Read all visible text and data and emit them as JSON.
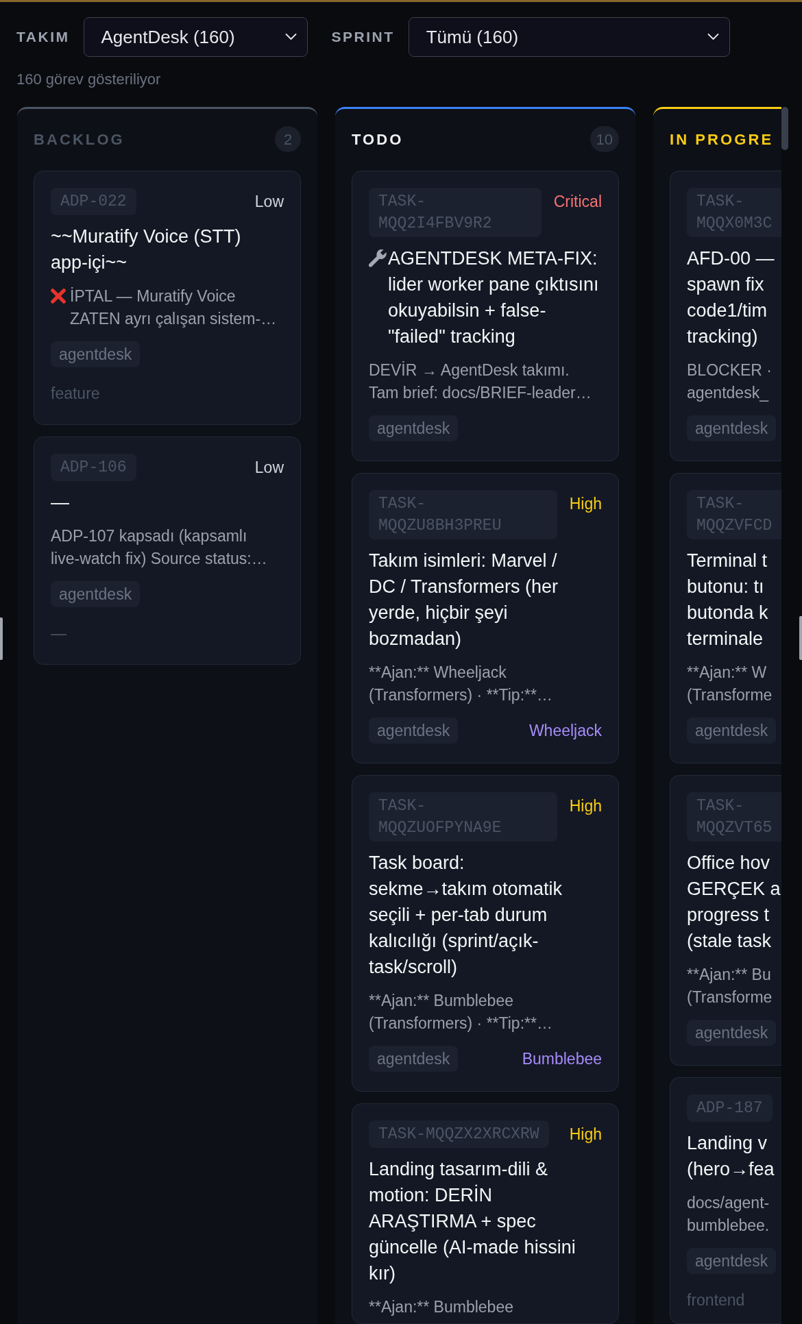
{
  "filters": [
    {
      "label": "TAKIM",
      "value": "AgentDesk (160)"
    },
    {
      "label": "SPRINT",
      "value": "Tümü (160)"
    }
  ],
  "summary": "160 görev gösteriliyor",
  "columns": [
    {
      "title": {
        "text": "BACKLOG",
        "color": "#4b5563"
      },
      "count": "2",
      "color": "#4b5563",
      "clipped": false,
      "cards": [
        {
          "kind": "cancelled",
          "id": "ADP-022",
          "priority": {
            "label": "Low",
            "color": "#d1d5db"
          },
          "title": "~~Muratify Voice (STT) app-içi~~",
          "description": "İPTAL — Muratify Voice ZATEN ayrı çalışan sistem-…",
          "tags": [
            "agentdesk"
          ],
          "type": "feature"
        },
        {
          "kind": "task",
          "id": "ADP-106",
          "priority": {
            "label": "Low",
            "color": "#d1d5db"
          },
          "title": "—",
          "description": "ADP-107 kapsadı (kapsamlı live-watch fix) Source status:…",
          "tags": [
            "agentdesk"
          ],
          "type": "—"
        }
      ]
    },
    {
      "title": {
        "text": "TODO",
        "color": "#f3f4f6"
      },
      "count": "10",
      "color": "#3b82f6",
      "clipped": false,
      "cards": [
        {
          "kind": "fix",
          "id": "TASK-MQQ2I4FBV9R2",
          "priority": {
            "label": "Critical",
            "color": "#f87171"
          },
          "title": "AGENTDESK META-FIX: lider worker pane çıktısını okuyabilsin + false-\"failed\" tracking",
          "description": "DEVİR → AgentDesk takımı. Tam brief: docs/BRIEF-leader…",
          "tags": [
            "agentdesk"
          ]
        },
        {
          "kind": "task",
          "id": "TASK-MQQZU8BH3PREU",
          "priority": {
            "label": "High",
            "color": "#facc15"
          },
          "title": "Takım isimleri: Marvel / DC / Transformers (her yerde, hiçbir şeyi bozmadan)",
          "description": "**Ajan:** Wheeljack (Transformers) · **Tip:**…",
          "tags": [
            "agentdesk"
          ],
          "agent": "Wheeljack"
        },
        {
          "kind": "task",
          "id": "TASK-MQQZUOFPYNA9E",
          "priority": {
            "label": "High",
            "color": "#facc15"
          },
          "title": "Task board: sekme→takım otomatik seçili + per-tab durum kalıcılığı (sprint/açık-task/scroll)",
          "description": "**Ajan:** Bumblebee (Transformers) · **Tip:**…",
          "tags": [
            "agentdesk"
          ],
          "agent": "Bumblebee"
        },
        {
          "kind": "task",
          "id": "TASK-MQQZX2XRCXRW",
          "priority": {
            "label": "High",
            "color": "#facc15"
          },
          "title": "Landing tasarım-dili & motion: DERİN ARAŞTIRMA + spec güncelle (AI-made hissini kır)",
          "description": "**Ajan:** Bumblebee"
        }
      ]
    },
    {
      "title": {
        "text": "IN PROGRE",
        "color": "#facc15"
      },
      "color": "#facc15",
      "clipped": true,
      "cards": [
        {
          "kind": "task",
          "id": [
            "TASK-",
            "MQQX0M3C"
          ],
          "title": [
            "AFD-00 —",
            "spawn fix",
            "code1/tim",
            "tracking)"
          ],
          "description": [
            "BLOCKER ·",
            "agentdesk_"
          ],
          "tags": [
            "agentdesk"
          ]
        },
        {
          "kind": "task",
          "id": [
            "TASK-",
            "MQQZVFCD"
          ],
          "title": [
            "Terminal t",
            "butonu: tı",
            "butonda k",
            "terminale"
          ],
          "description": [
            "**Ajan:** W",
            "(Transforme"
          ],
          "tags": [
            "agentdesk"
          ]
        },
        {
          "kind": "task",
          "id": [
            "TASK-",
            "MQQZVT65"
          ],
          "title": [
            "Office hov",
            "GERÇEK a",
            "progress t",
            "(stale task"
          ],
          "description": [
            "**Ajan:** Bu",
            "(Transforme"
          ],
          "tags": [
            "agentdesk"
          ]
        },
        {
          "kind": "task",
          "id": "ADP-187",
          "title": [
            "Landing v",
            "(hero→fea"
          ],
          "description": [
            "docs/agent-",
            "bumblebee."
          ],
          "tags": [
            "agentdesk"
          ],
          "type": "frontend"
        }
      ]
    }
  ]
}
